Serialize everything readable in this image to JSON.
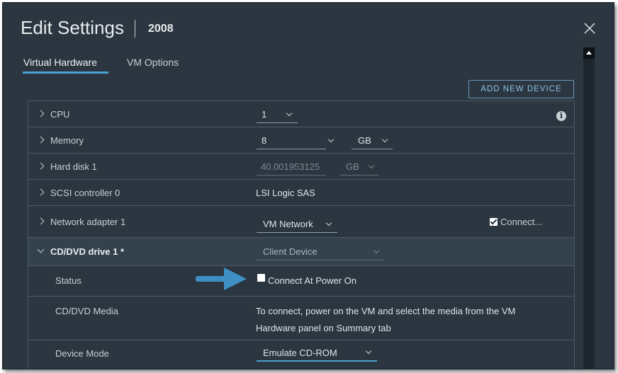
{
  "dialog": {
    "title": "Edit Settings",
    "subtitle": "2008",
    "close_icon": "close-icon"
  },
  "tabs": [
    {
      "label": "Virtual Hardware",
      "active": true
    },
    {
      "label": "VM Options",
      "active": false
    }
  ],
  "add_device_label": "ADD NEW DEVICE",
  "rows": {
    "cpu": {
      "label": "CPU",
      "value": "1"
    },
    "memory": {
      "label": "Memory",
      "value": "8",
      "unit": "GB"
    },
    "hard_disk": {
      "label": "Hard disk 1",
      "value": "40.001953125",
      "unit": "GB"
    },
    "scsi": {
      "label": "SCSI controller 0",
      "value": "LSI Logic SAS"
    },
    "network": {
      "label": "Network adapter 1",
      "value": "VM Network",
      "connect_label": "Connect...",
      "connect_checked": true
    },
    "cdrom": {
      "label": "CD/DVD drive 1 *",
      "value": "Client Device"
    },
    "status": {
      "label": "Status",
      "checkbox_label": "Connect At Power On",
      "checked": false
    },
    "media": {
      "label": "CD/DVD Media",
      "text_line1": "To connect, power on the VM and select the media from the VM",
      "text_line2": "Hardware panel on Summary tab"
    },
    "device_mode": {
      "label": "Device Mode",
      "value": "Emulate CD-ROM"
    }
  },
  "colors": {
    "background": "#2b3640",
    "accent": "#4aa2d4",
    "annotation_arrow": "#3d8fc4"
  }
}
